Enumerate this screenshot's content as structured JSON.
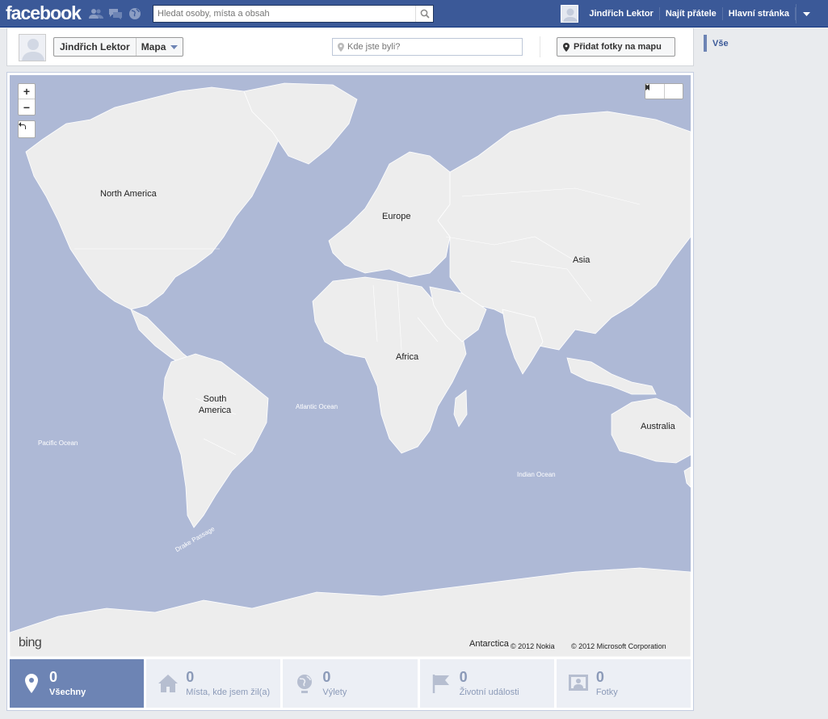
{
  "topbar": {
    "logo": "facebook",
    "search_placeholder": "Hledat osoby, místa a obsah",
    "user_name": "Jindřich Lektor",
    "find_friends": "Najít přátele",
    "home": "Hlavní stránka"
  },
  "header": {
    "profile_name": "Jindřich Lektor",
    "section": "Mapa",
    "where_placeholder": "Kde jste byli?",
    "add_photos": "Přidat fotky na mapu"
  },
  "sidebar": {
    "items": [
      {
        "label": "Vše"
      }
    ]
  },
  "map": {
    "continents": {
      "north_america": "North America",
      "south_america": "South\nAmerica",
      "europe": "Europe",
      "africa": "Africa",
      "asia": "Asia",
      "australia": "Australia",
      "antarctica": "Antarctica"
    },
    "oceans": {
      "atlantic": "Atlantic Ocean",
      "pacific": "Pacific Ocean",
      "indian": "Indian Ocean",
      "drake": "Drake Passage"
    },
    "copyright_nokia": "© 2012 Nokia",
    "copyright_microsoft": "© 2012 Microsoft Corporation",
    "provider": "bing",
    "zoom_in": "+",
    "zoom_out": "−"
  },
  "tabs": [
    {
      "count": "0",
      "label": "Všechny",
      "icon": "map-pin-icon",
      "active": true
    },
    {
      "count": "0",
      "label": "Místa, kde jsem žil(a)",
      "icon": "house-icon",
      "active": false
    },
    {
      "count": "0",
      "label": "Výlety",
      "icon": "globe-icon",
      "active": false
    },
    {
      "count": "0",
      "label": "Životní události",
      "icon": "flag-icon",
      "active": false
    },
    {
      "count": "0",
      "label": "Fotky",
      "icon": "photos-icon",
      "active": false
    }
  ],
  "colors": {
    "brand": "#3b5998",
    "active_tab": "#6d84b4",
    "water": "#aeb9d6",
    "land": "#ededed"
  }
}
